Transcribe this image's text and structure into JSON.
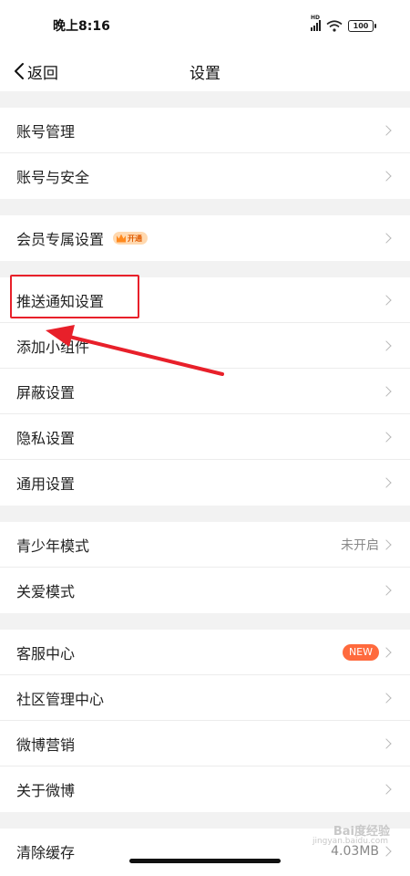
{
  "status_bar": {
    "time": "晚上8:16",
    "network_label": "HD",
    "battery": "100"
  },
  "nav": {
    "back_label": "返回",
    "title": "设置"
  },
  "groups": [
    {
      "items": [
        {
          "label": "账号管理"
        },
        {
          "label": "账号与安全"
        }
      ]
    },
    {
      "items": [
        {
          "label": "会员专属设置",
          "badge": "开通"
        }
      ]
    },
    {
      "items": [
        {
          "label": "推送通知设置"
        },
        {
          "label": "添加小组件"
        },
        {
          "label": "屏蔽设置"
        },
        {
          "label": "隐私设置"
        },
        {
          "label": "通用设置"
        }
      ]
    },
    {
      "items": [
        {
          "label": "青少年模式",
          "value": "未开启"
        },
        {
          "label": "关爱模式"
        }
      ]
    },
    {
      "items": [
        {
          "label": "客服中心",
          "badge": "NEW"
        },
        {
          "label": "社区管理中心"
        },
        {
          "label": "微博营销"
        },
        {
          "label": "关于微博"
        }
      ]
    },
    {
      "items": [
        {
          "label": "清除缓存",
          "value": "4.03MB"
        }
      ]
    }
  ],
  "watermark": {
    "main": "Bai度经验",
    "sub": "jingyan.baidu.com"
  },
  "colors": {
    "annotation": "#e8202a",
    "new_badge": "#ff6a3d",
    "vip": "#ff8a1f"
  }
}
